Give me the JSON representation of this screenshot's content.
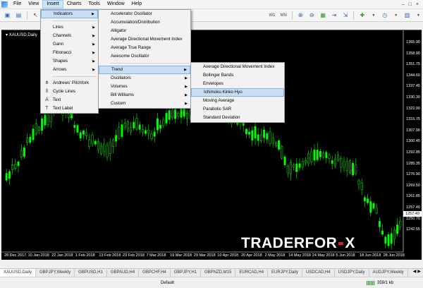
{
  "menubar": {
    "items": [
      "File",
      "View",
      "Insert",
      "Charts",
      "Tools",
      "Window",
      "Help"
    ],
    "active_index": 2,
    "window_controls": [
      "–",
      "□",
      "×"
    ]
  },
  "toolbar": {
    "timeframes": [
      "W1",
      "MN"
    ]
  },
  "chart": {
    "title": "XAUUSD,Daily",
    "background": "#000000",
    "candle_color": "#00ff00",
    "price_labels": [
      "1365.90",
      "1358.90",
      "1351.75",
      "1344.60",
      "1337.45",
      "1330.30",
      "1322.90",
      "1315.75",
      "1307.90",
      "1300.45",
      "1292.85",
      "1285.35",
      "1276.90",
      "1269.50",
      "1261.85",
      "1257.40",
      "1250.70",
      "1242.55"
    ],
    "current_price": "1257.40",
    "date_labels": [
      "28 Dec 2017",
      "10 Jan 2018",
      "22 Jan 2018",
      "1 Feb 2018",
      "13 Feb 2018",
      "23 Feb 2018",
      "7 Mar 2018",
      "19 Mar 2018",
      "29 Mar 2018",
      "10 Apr 2018",
      "20 Apr 2018",
      "2 May 2018",
      "14 May 2018",
      "24 May 2018",
      "5 Jun 2018",
      "18 Jun 2018",
      "28 Jun 2018"
    ],
    "watermark_left": "TRADERFOR",
    "watermark_right": "X"
  },
  "insert_menu": {
    "items": [
      {
        "label": "Indicators",
        "submenu": true
      },
      {
        "label": "Lines",
        "submenu": true
      },
      {
        "label": "Channels",
        "submenu": true
      },
      {
        "label": "Gann",
        "submenu": true
      },
      {
        "label": "Fibonacci",
        "submenu": true
      },
      {
        "label": "Shapes",
        "submenu": true
      },
      {
        "label": "Arrows",
        "submenu": true
      },
      {
        "label": "Andrews' Pitchfork",
        "submenu": false
      },
      {
        "label": "Cycle Lines",
        "submenu": false
      },
      {
        "label": "Text",
        "submenu": false
      },
      {
        "label": "Text Label",
        "submenu": false
      }
    ]
  },
  "indicators_menu": {
    "items": [
      {
        "label": "Accelerator Oscillator",
        "submenu": false
      },
      {
        "label": "Accumulation/Distribution",
        "submenu": false
      },
      {
        "label": "Alligator",
        "submenu": false
      },
      {
        "label": "Average Directional Movement Index",
        "submenu": false
      },
      {
        "label": "Average True Range",
        "submenu": false
      },
      {
        "label": "Awesome Oscillator",
        "submenu": false
      },
      {
        "label": "Trend",
        "submenu": true
      },
      {
        "label": "Oscillators",
        "submenu": true
      },
      {
        "label": "Volumes",
        "submenu": true
      },
      {
        "label": "Bill Williams",
        "submenu": true
      },
      {
        "label": "Custom",
        "submenu": true
      }
    ]
  },
  "trend_menu": {
    "items": [
      "Average Directional Movement Index",
      "Bollinger Bands",
      "Envelopes",
      "Ichimoku Kinko Hyo",
      "Moving Average",
      "Parabolic SAR",
      "Standard Deviation"
    ],
    "highlighted": "Ichimoku Kinko Hyo"
  },
  "tabs": {
    "items": [
      "XAUUSD,Daily",
      "GBPJPY,Weekly",
      "GBPUSD,H1",
      "GBPAUD,H4",
      "GBPCHF,H4",
      "GBPJPY,H1",
      "GBPNZD,M15",
      "EURCAD,H4",
      "EURJPY,Daily",
      "USDCAD,H4",
      "USDJPY,Daily",
      "AUDJPY,Weekly"
    ],
    "active_index": 0
  },
  "statusbar": {
    "profile": "Default",
    "traffic": "359/1 kb"
  }
}
